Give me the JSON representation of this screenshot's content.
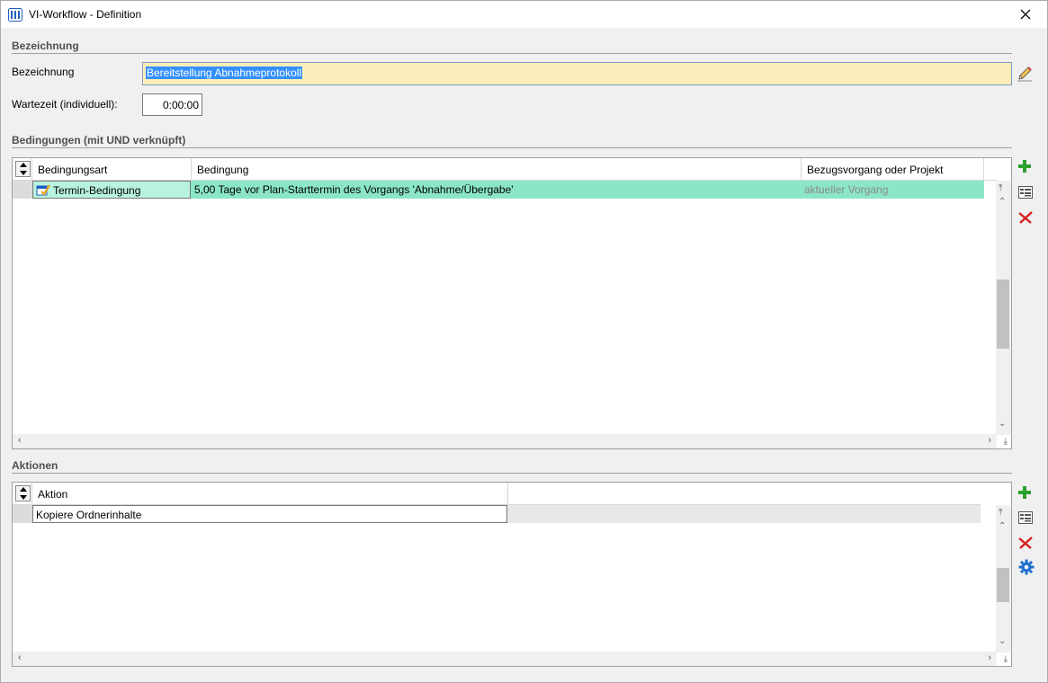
{
  "window": {
    "title": "VI-Workflow - Definition"
  },
  "bezeichnung_section": {
    "title": "Bezeichnung",
    "name_label": "Bezeichnung",
    "name_value": "Bereitstellung Abnahmeprotokoll",
    "wait_label": "Wartezeit (individuell):",
    "wait_value": "0:00:00"
  },
  "conditions": {
    "title": "Bedingungen (mit UND verknüpft)",
    "columns": [
      "Bedingungsart",
      "Bedingung",
      "Bezugsvorgang oder Projekt"
    ],
    "rows": [
      {
        "type": "Termin-Bedingung",
        "condition": "5,00 Tage vor Plan-Starttermin des Vorgangs 'Abnahme/Übergabe'",
        "reference": "aktueller Vorgang"
      }
    ]
  },
  "actions": {
    "title": "Aktionen",
    "columns": [
      "Aktion"
    ],
    "rows": [
      {
        "action": "Kopiere Ordnerinhalte"
      }
    ]
  },
  "icons": {
    "add": "plus-icon",
    "edit": "edit-list-icon",
    "delete": "delete-x-icon",
    "settings": "gear-icon",
    "sort": "sort-arrows-icon",
    "pencil": "pencil-icon",
    "close": "close-icon",
    "app": "app-columns-icon",
    "condition_type": "calendar-check-icon"
  },
  "colors": {
    "selected_row": "#8be6c7",
    "selected_cell": "#b8f3df",
    "name_input_bg": "#fdeebb",
    "selection_blue": "#3390ff",
    "add_green": "#2ca02c",
    "delete_red": "#d62020",
    "gear_blue": "#1f6fd1"
  }
}
